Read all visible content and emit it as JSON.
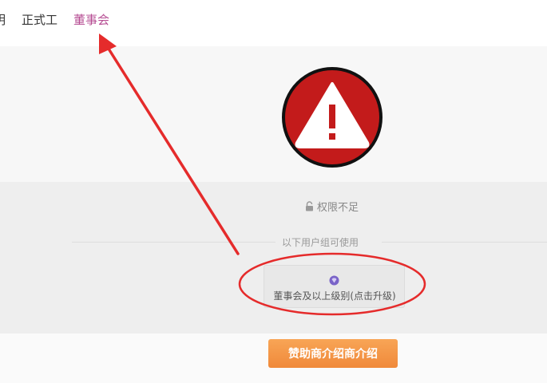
{
  "nav": {
    "items": [
      {
        "label": "明"
      },
      {
        "label": "正式工"
      },
      {
        "label": "董事会"
      }
    ]
  },
  "notice": {
    "permission_text": "权限不足",
    "divider_text": "以下用户组可使用",
    "group_label": "董事会及以上级别(点击升级)",
    "button_label": "赞助商介绍商介绍"
  },
  "colors": {
    "active_nav": "#b64d93",
    "warning_red": "#c31b1b",
    "button_orange": "#f39240",
    "annotation_red": "#e52b2b"
  },
  "icons": {
    "warning": "warning-triangle-icon",
    "lock": "lock-icon",
    "group": "group-gem-icon"
  }
}
